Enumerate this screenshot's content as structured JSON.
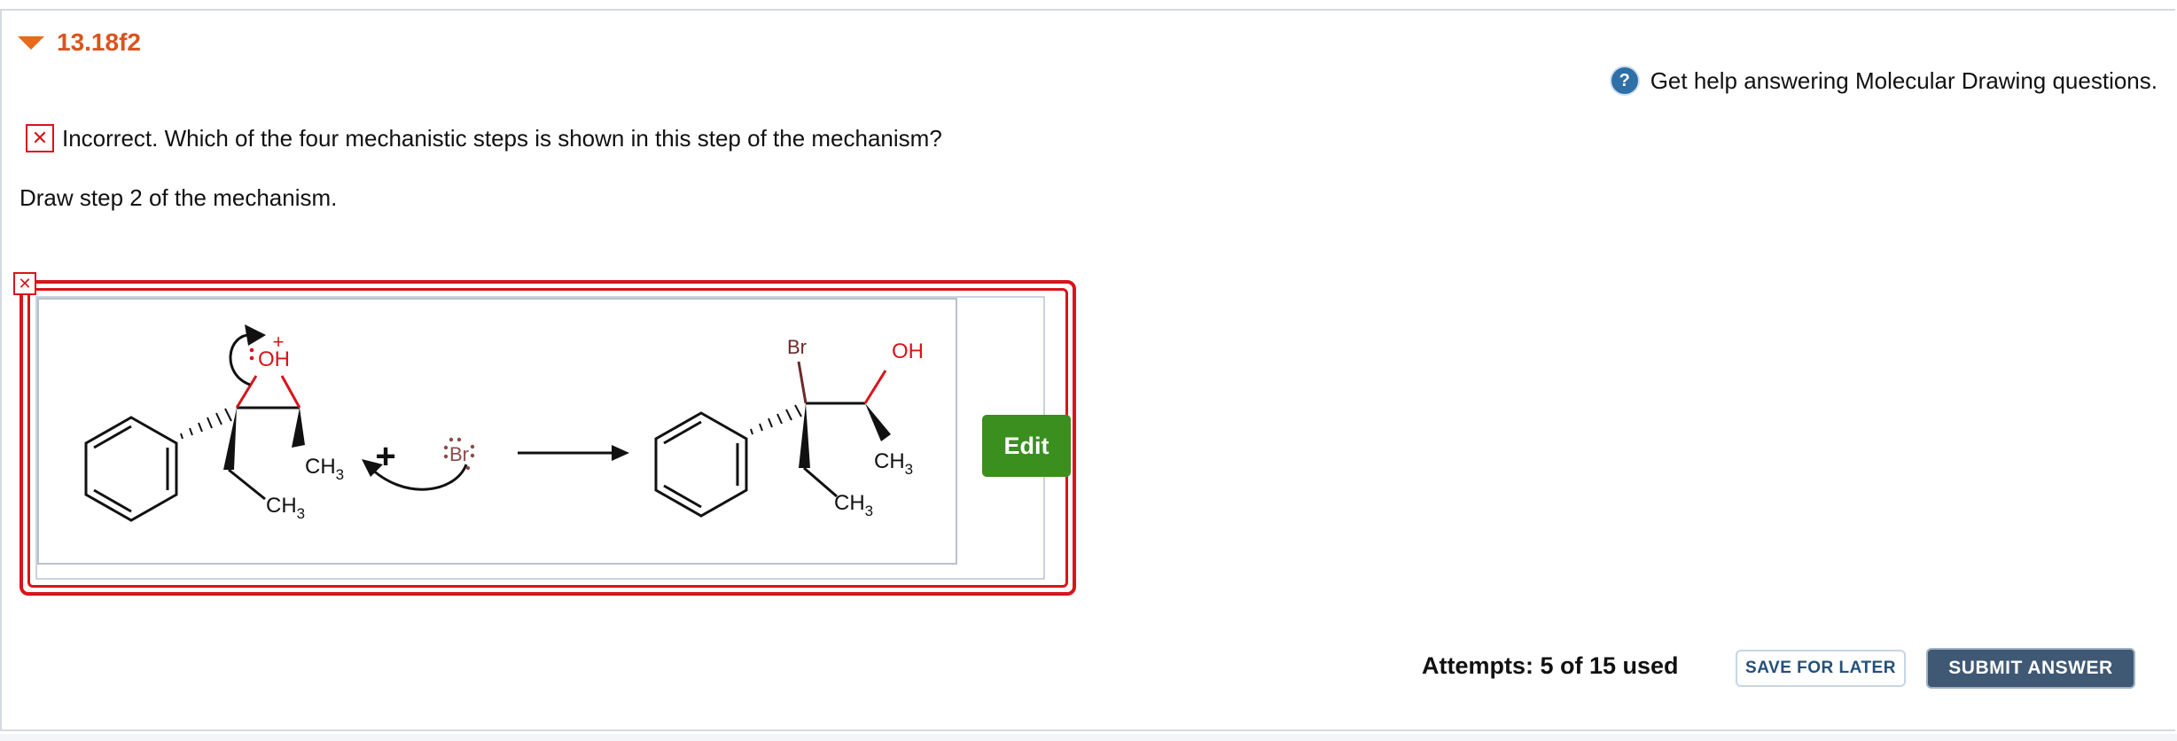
{
  "question": {
    "title": "13.18f2"
  },
  "help": {
    "icon": "question-circle-icon",
    "text": "Get help answering Molecular Drawing questions."
  },
  "feedback": {
    "icon": "x-mark-icon",
    "status_color": "#d9141b",
    "text": "Incorrect. Which of the four mechanistic steps is shown in this step of the mechanism?"
  },
  "instruction": "Draw step 2 of the mechanism.",
  "drawing": {
    "labels": {
      "oh_left": "OH",
      "charge_plus": "+",
      "ch3_a": "CH",
      "ch3_a_sub": "3",
      "ch3_b": "CH",
      "ch3_b_sub": "3",
      "reaction_plus": "+",
      "br_ion": "Br",
      "br_product": "Br",
      "oh_right": "OH",
      "ch3_c": "CH",
      "ch3_c_sub": "3",
      "ch3_d": "CH",
      "ch3_d_sub": "3"
    },
    "edit_label": "Edit",
    "accent_color": "#3a8f1f"
  },
  "footer": {
    "attempts": "Attempts: 5 of 15 used",
    "save_label": "SAVE FOR LATER",
    "submit_label": "SUBMIT ANSWER"
  }
}
